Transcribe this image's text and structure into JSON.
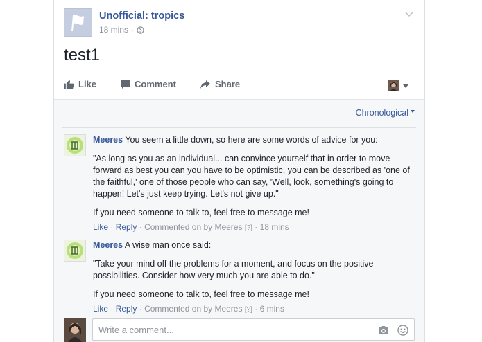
{
  "post": {
    "page_name": "Unofficial: tropics",
    "time": "18 mins",
    "separator": "·",
    "text": "test1"
  },
  "actions": {
    "like": "Like",
    "comment": "Comment",
    "share": "Share"
  },
  "comments_sort": "Chronological",
  "comments": [
    {
      "author": "Meeres",
      "intro": "You seem a little down, so here are some words of advice for you:",
      "quote": "\"As long as you as an individual... can convince yourself that in order to move forward as best you can you have to be optimistic, you can be described as 'one of the faithful,' one of those people who can say, 'Well, look, something's going to happen! Let's just keep trying. Let's not give up.\"",
      "outro": "If you need someone to talk to, feel free to message me!",
      "like": "Like",
      "reply": "Reply",
      "attribution": "Commented on by Meeres",
      "help": "[?]",
      "time": "18 mins"
    },
    {
      "author": "Meeres",
      "intro": "A wise man once said:",
      "quote": "\"Take your mind off the problems for a moment, and focus on the positive possibilities. Consider how very much you are able to do.\"",
      "outro": "If you need someone to talk to, feel free to message me!",
      "like": "Like",
      "reply": "Reply",
      "attribution": "Commented on by Meeres",
      "help": "[?]",
      "time": "6 mins"
    }
  ],
  "composer": {
    "placeholder": "Write a comment..."
  },
  "colors": {
    "link": "#365899",
    "meta": "#90949c",
    "background": "#f6f7f9"
  },
  "icons": [
    "globe-icon",
    "chevron-down-icon",
    "like-icon",
    "comment-icon",
    "share-icon",
    "camera-icon",
    "smiley-icon",
    "dropdown-triangle-icon"
  ]
}
